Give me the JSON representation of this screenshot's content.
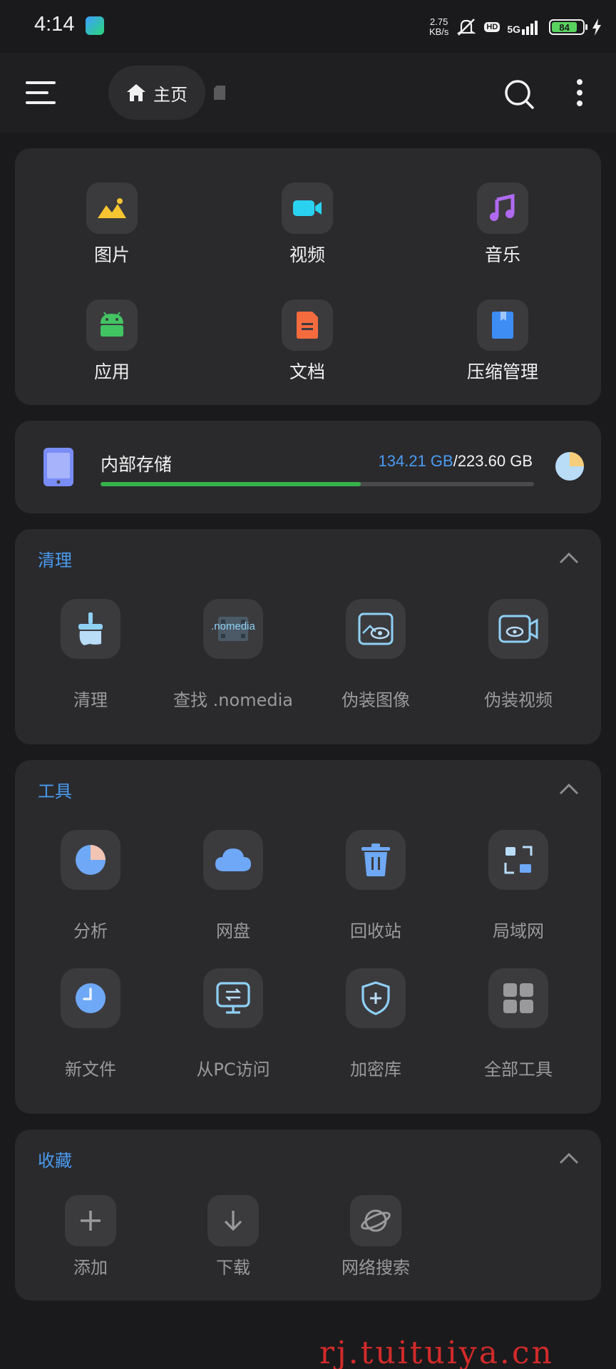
{
  "status_bar": {
    "time": "4:14",
    "net_speed_value": "2.75",
    "net_speed_unit": "KB/s",
    "hd_label": "HD",
    "network_label": "5G",
    "battery_level": "84"
  },
  "header": {
    "home_label": "主页"
  },
  "categories": [
    {
      "label": "图片",
      "icon": "image-icon"
    },
    {
      "label": "视频",
      "icon": "video-icon"
    },
    {
      "label": "音乐",
      "icon": "music-icon"
    },
    {
      "label": "应用",
      "icon": "android-icon"
    },
    {
      "label": "文档",
      "icon": "document-icon"
    },
    {
      "label": "压缩管理",
      "icon": "archive-icon"
    }
  ],
  "storage": {
    "title": "内部存储",
    "used": "134.21 GB",
    "separator": "/",
    "total": "223.60 GB",
    "used_fraction": 0.6
  },
  "cleanup": {
    "title": "清理",
    "items": [
      {
        "label": "清理",
        "icon": "broom-icon"
      },
      {
        "label": "查找 .nomedia",
        "icon_text": ".nomedia",
        "icon": "nomedia-icon"
      },
      {
        "label": "伪装图像",
        "icon": "disguise-image-icon"
      },
      {
        "label": "伪装视频",
        "icon": "disguise-video-icon"
      }
    ]
  },
  "tools": {
    "title": "工具",
    "items": [
      {
        "label": "分析",
        "icon": "pie-chart-icon"
      },
      {
        "label": "网盘",
        "icon": "cloud-icon"
      },
      {
        "label": "回收站",
        "icon": "trash-icon"
      },
      {
        "label": "局域网",
        "icon": "lan-icon"
      },
      {
        "label": "新文件",
        "icon": "clock-icon"
      },
      {
        "label": "从PC访问",
        "icon": "pc-transfer-icon"
      },
      {
        "label": "加密库",
        "icon": "shield-plus-icon"
      },
      {
        "label": "全部工具",
        "icon": "grid-icon"
      }
    ]
  },
  "favorites": {
    "title": "收藏",
    "items": [
      {
        "label": "添加",
        "icon": "plus-icon"
      },
      {
        "label": "下载",
        "icon": "download-icon"
      },
      {
        "label": "网络搜索",
        "icon": "planet-icon"
      }
    ]
  },
  "watermark": "rj.tuituiya.cn",
  "colors": {
    "accent": "#4a9bf0",
    "card": "#2a2a2d",
    "background": "#1a1a1c",
    "progress": "#36b24a"
  }
}
